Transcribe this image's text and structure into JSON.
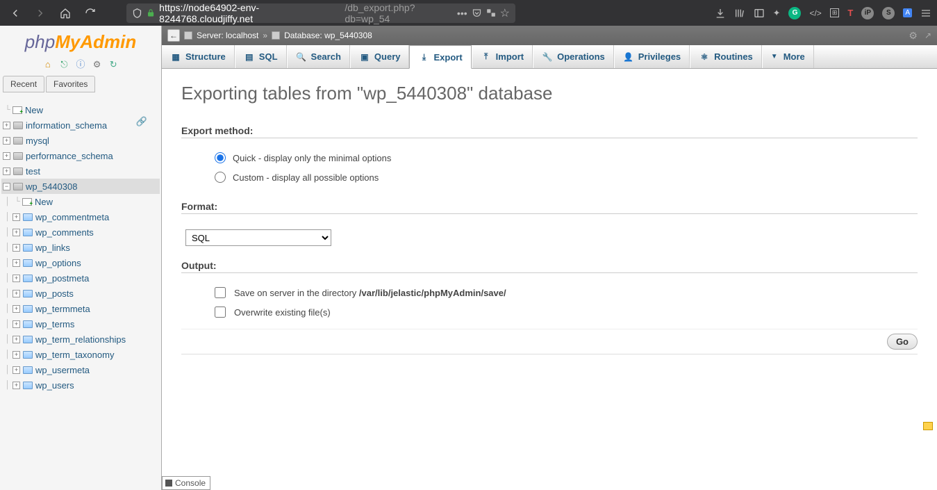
{
  "browser": {
    "url_domain": "https://node64902-env-8244768.cloudjiffy.net",
    "url_path": "/db_export.php?db=wp_54"
  },
  "logo": {
    "php": "php",
    "my": "My",
    "admin": "Admin"
  },
  "rf_tabs": {
    "recent": "Recent",
    "favorites": "Favorites"
  },
  "tree": {
    "new": "New",
    "dbs": [
      {
        "id": "information_schema",
        "label": "information_schema"
      },
      {
        "id": "mysql",
        "label": "mysql"
      },
      {
        "id": "performance_schema",
        "label": "performance_schema"
      },
      {
        "id": "test",
        "label": "test"
      }
    ],
    "current_db": "wp_5440308",
    "db_new": "New",
    "tables": [
      "wp_commentmeta",
      "wp_comments",
      "wp_links",
      "wp_options",
      "wp_postmeta",
      "wp_posts",
      "wp_termmeta",
      "wp_terms",
      "wp_term_relationships",
      "wp_term_taxonomy",
      "wp_usermeta",
      "wp_users"
    ]
  },
  "crumb": {
    "server_label": "Server: localhost",
    "sep": "»",
    "db_label": "Database: wp_5440308"
  },
  "tabs": [
    {
      "id": "structure",
      "label": "Structure"
    },
    {
      "id": "sql",
      "label": "SQL"
    },
    {
      "id": "search",
      "label": "Search"
    },
    {
      "id": "query",
      "label": "Query"
    },
    {
      "id": "export",
      "label": "Export"
    },
    {
      "id": "import",
      "label": "Import"
    },
    {
      "id": "operations",
      "label": "Operations"
    },
    {
      "id": "privileges",
      "label": "Privileges"
    },
    {
      "id": "routines",
      "label": "Routines"
    },
    {
      "id": "more",
      "label": "More"
    }
  ],
  "page": {
    "title": "Exporting tables from \"wp_5440308\" database",
    "export_method": "Export method:",
    "quick": "Quick - display only the minimal options",
    "custom": "Custom - display all possible options",
    "format": "Format:",
    "format_value": "SQL",
    "output": "Output:",
    "save_prefix": "Save on server in the directory ",
    "save_path": "/var/lib/jelastic/phpMyAdmin/save/",
    "overwrite": "Overwrite existing file(s)",
    "go": "Go"
  },
  "console": "Console"
}
